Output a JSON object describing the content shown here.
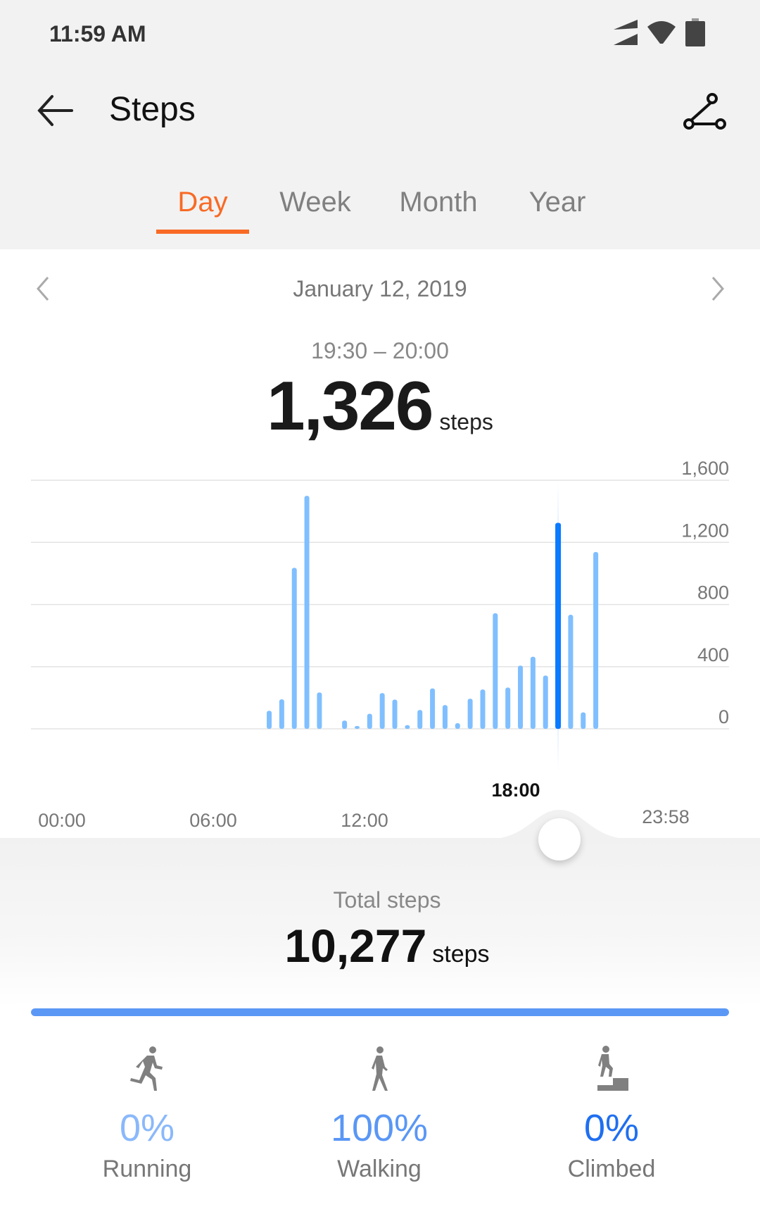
{
  "status_bar": {
    "time": "11:59 AM",
    "icons": [
      "signal-icon",
      "wifi-icon",
      "battery-icon"
    ]
  },
  "toolbar": {
    "title": "Steps",
    "back_icon": "arrow-left-icon",
    "action_icon": "route-icon"
  },
  "tabs": [
    {
      "label": "Day",
      "active": true
    },
    {
      "label": "Week"
    },
    {
      "label": "Month"
    },
    {
      "label": "Year"
    }
  ],
  "date_nav": {
    "date": "January 12, 2019"
  },
  "selection": {
    "range": "19:30 – 20:00",
    "steps": "1,326",
    "unit": "steps"
  },
  "colors": {
    "accent": "#f86a25",
    "bar": "#80bfff",
    "bar_selected": "#0a7aff",
    "progress": "#5b98f6",
    "running": "#8ab8fb",
    "walking": "#5a97f5",
    "climbed": "#1f6ff0"
  },
  "chart_data": {
    "type": "bar",
    "ylim": [
      0,
      1600
    ],
    "yticks": [
      "1,600",
      "1,200",
      "800",
      "400",
      "0"
    ],
    "ytick_values": [
      1600,
      1200,
      800,
      400,
      0
    ],
    "xticks": [
      "00:00",
      "06:00",
      "12:00",
      "18:00",
      "23:58"
    ],
    "selected_xtick": "18:00",
    "grid": true,
    "selected": "19:30",
    "x": [
      "08:00",
      "08:30",
      "09:00",
      "09:30",
      "10:00",
      "10:30",
      "11:00",
      "11:30",
      "12:00",
      "12:30",
      "13:00",
      "13:30",
      "14:00",
      "14:30",
      "15:00",
      "15:30",
      "16:00",
      "16:30",
      "17:00",
      "17:30",
      "18:00",
      "18:30",
      "19:00",
      "19:30",
      "20:00",
      "20:30",
      "21:00"
    ],
    "values": [
      116,
      190,
      1036,
      1500,
      234,
      0,
      53,
      18,
      97,
      230,
      188,
      24,
      121,
      260,
      153,
      36,
      194,
      253,
      744,
      266,
      407,
      464,
      343,
      1326,
      734,
      106,
      1138
    ]
  },
  "summary": {
    "label": "Total steps",
    "steps": "10,277",
    "unit": "steps",
    "progress": 1.0
  },
  "breakdown": [
    {
      "icon": "running-icon",
      "percent": "0%",
      "label": "Running"
    },
    {
      "icon": "walking-icon",
      "percent": "100%",
      "label": "Walking"
    },
    {
      "icon": "climbing-icon",
      "percent": "0%",
      "label": "Climbed"
    }
  ]
}
